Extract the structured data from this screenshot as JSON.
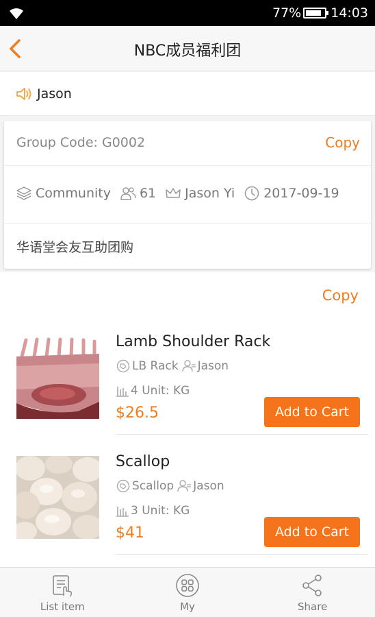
{
  "status_bar": {
    "battery": "77%",
    "time": "14:03"
  },
  "header": {
    "title": "NBC成员福利团"
  },
  "notice": {
    "text": "Jason"
  },
  "group": {
    "code_label": "Group Code: G0002",
    "copy_label": "Copy",
    "type": "Community",
    "members": "61",
    "leader": "Jason Yi",
    "date": "2017-09-19",
    "description": "华语堂会友互助团购"
  },
  "products": {
    "copy_label": "Copy",
    "items": [
      {
        "name": "Lamb Shoulder Rack",
        "tag": "LB Rack",
        "owner": "Jason",
        "stock": "4 Unit: KG",
        "price": "$26.5",
        "button": "Add to Cart"
      },
      {
        "name": "Scallop",
        "tag": "Scallop",
        "owner": "Jason",
        "stock": "3 Unit: KG",
        "price": "$41",
        "button": "Add to Cart"
      }
    ]
  },
  "tabs": [
    {
      "label": "List item",
      "icon": "list-item-icon"
    },
    {
      "label": "My",
      "icon": "grid-icon"
    },
    {
      "label": "Share",
      "icon": "share-icon"
    }
  ],
  "colors": {
    "accent": "#f07c1c",
    "button": "#f5731b",
    "status_bar": "#000000"
  }
}
